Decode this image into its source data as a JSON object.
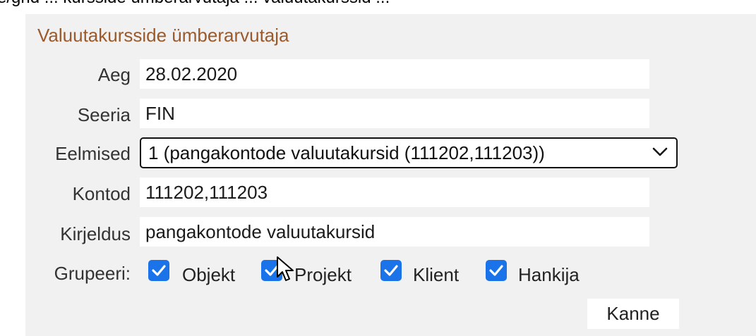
{
  "top_fragment": "e/grid ... kursside ümberarvutaja ... valuutakurssid ...",
  "panel": {
    "title": "Valuutakursside ümberarvutaja",
    "fields": [
      {
        "label": "Aeg",
        "value": "28.02.2020"
      },
      {
        "label": "Seeria",
        "value": "FIN"
      },
      {
        "label": "Kontod",
        "value": "111202,111203"
      },
      {
        "label": "Kirjeldus",
        "value": "pangakontode valuutakursid"
      }
    ],
    "eelmised": {
      "label": "Eelmised",
      "selected": "1 (pangakontode valuutakursid (111202,111203))"
    },
    "grupeeri": {
      "label": "Grupeeri:",
      "options": [
        {
          "label": "Objekt",
          "checked": true
        },
        {
          "label": "Projekt",
          "checked": true
        },
        {
          "label": "Klient",
          "checked": true
        },
        {
          "label": "Hankija",
          "checked": true
        }
      ]
    },
    "submit_label": "Kanne"
  },
  "colors": {
    "panel_bg": "#f1f1f1",
    "title": "#9a5a2c",
    "checkbox": "#1a73e8"
  },
  "icons": {
    "select_chevron": "chevron-down-icon",
    "checkmark": "check-icon",
    "cursor": "mouse-pointer-icon"
  }
}
